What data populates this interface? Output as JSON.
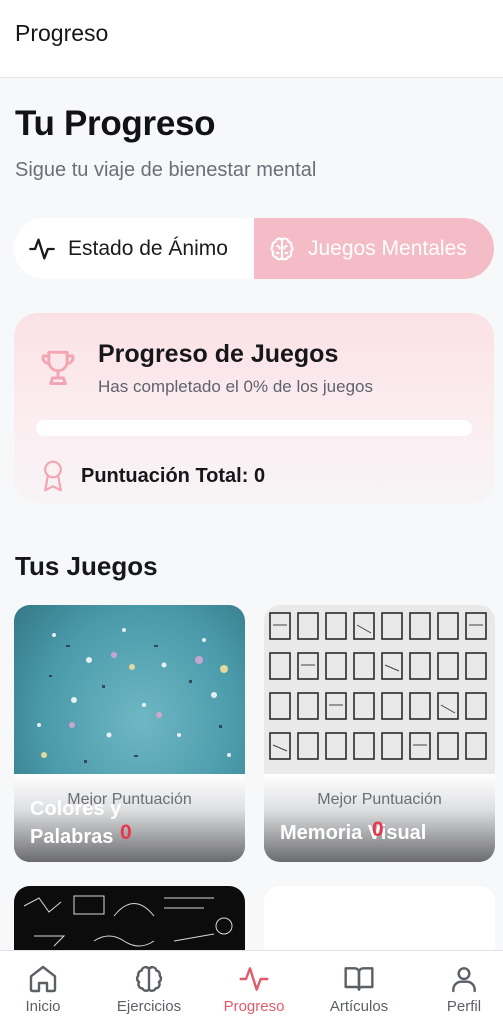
{
  "topbar": {
    "title": "Progreso"
  },
  "header": {
    "title": "Tu Progreso",
    "subtitle": "Sigue tu viaje de bienestar mental"
  },
  "segment": {
    "mood_label": "Estado de Ánimo",
    "games_label": "Juegos Mentales",
    "active": "games"
  },
  "progress_card": {
    "title": "Progreso de Juegos",
    "subtitle": "Has completado el 0% de los juegos",
    "completion_fraction": 0,
    "score_label": "Puntuación Total: 0"
  },
  "games_section": {
    "title": "Tus Juegos",
    "games": [
      {
        "name": "Colores y Palabras",
        "best_label": "Mejor Puntuación",
        "best_score": "0"
      },
      {
        "name": "Memoria Visual",
        "best_label": "Mejor Puntuación",
        "best_score": "0"
      }
    ]
  },
  "tabbar": {
    "items": [
      {
        "label": "Inicio",
        "icon": "home-icon"
      },
      {
        "label": "Ejercicios",
        "icon": "brain-icon"
      },
      {
        "label": "Progreso",
        "icon": "activity-icon"
      },
      {
        "label": "Artículos",
        "icon": "book-icon"
      },
      {
        "label": "Perfil",
        "icon": "user-icon"
      }
    ],
    "active": "Progreso"
  },
  "colors": {
    "accent": "#e55a6b",
    "segment_active": "#f4bcc6",
    "score_red": "#e8364e"
  }
}
